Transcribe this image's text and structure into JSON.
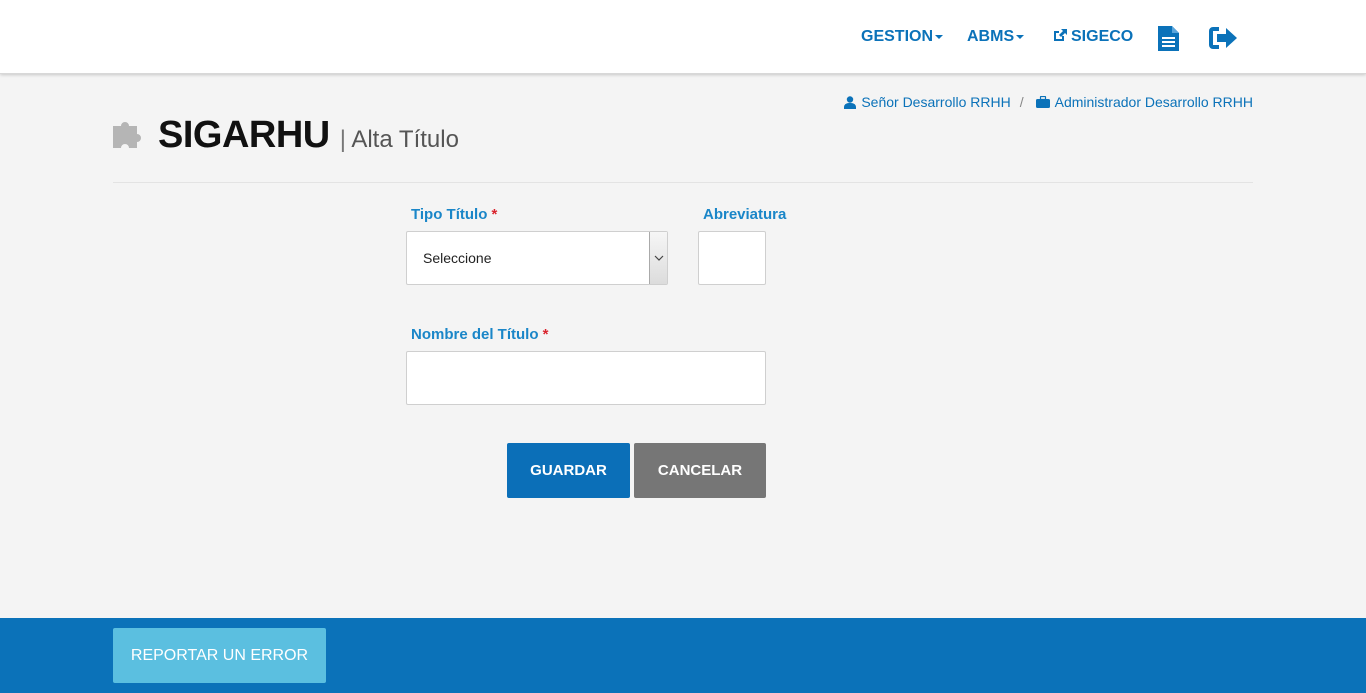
{
  "nav": {
    "gestion_label": "GESTION",
    "abms_label": "ABMS",
    "sigeco_label": "SIGECO",
    "icons": [
      "external-link-icon",
      "document-icon",
      "logout-icon"
    ]
  },
  "breadcrumb": {
    "user": "Señor Desarrollo RRHH",
    "separator": "/",
    "role": "Administrador Desarrollo RRHH"
  },
  "header": {
    "app_name": "SIGARHU",
    "separator": "|",
    "page_name": "Alta Título"
  },
  "form": {
    "tipo_titulo_label": "Tipo Título",
    "tipo_titulo_value": "Seleccione",
    "abreviatura_label": "Abreviatura",
    "abreviatura_value": "",
    "nombre_label": "Nombre del Título",
    "nombre_value": "",
    "required_mark": "*"
  },
  "actions": {
    "save_label": "GUARDAR",
    "cancel_label": "CANCELAR"
  },
  "footer": {
    "report_label": "REPORTAR UN ERROR"
  },
  "colors": {
    "primary": "#0b72b9",
    "label": "#1a86c8",
    "required": "#d9232d",
    "cancel": "#767676",
    "report": "#5bbfe0"
  }
}
